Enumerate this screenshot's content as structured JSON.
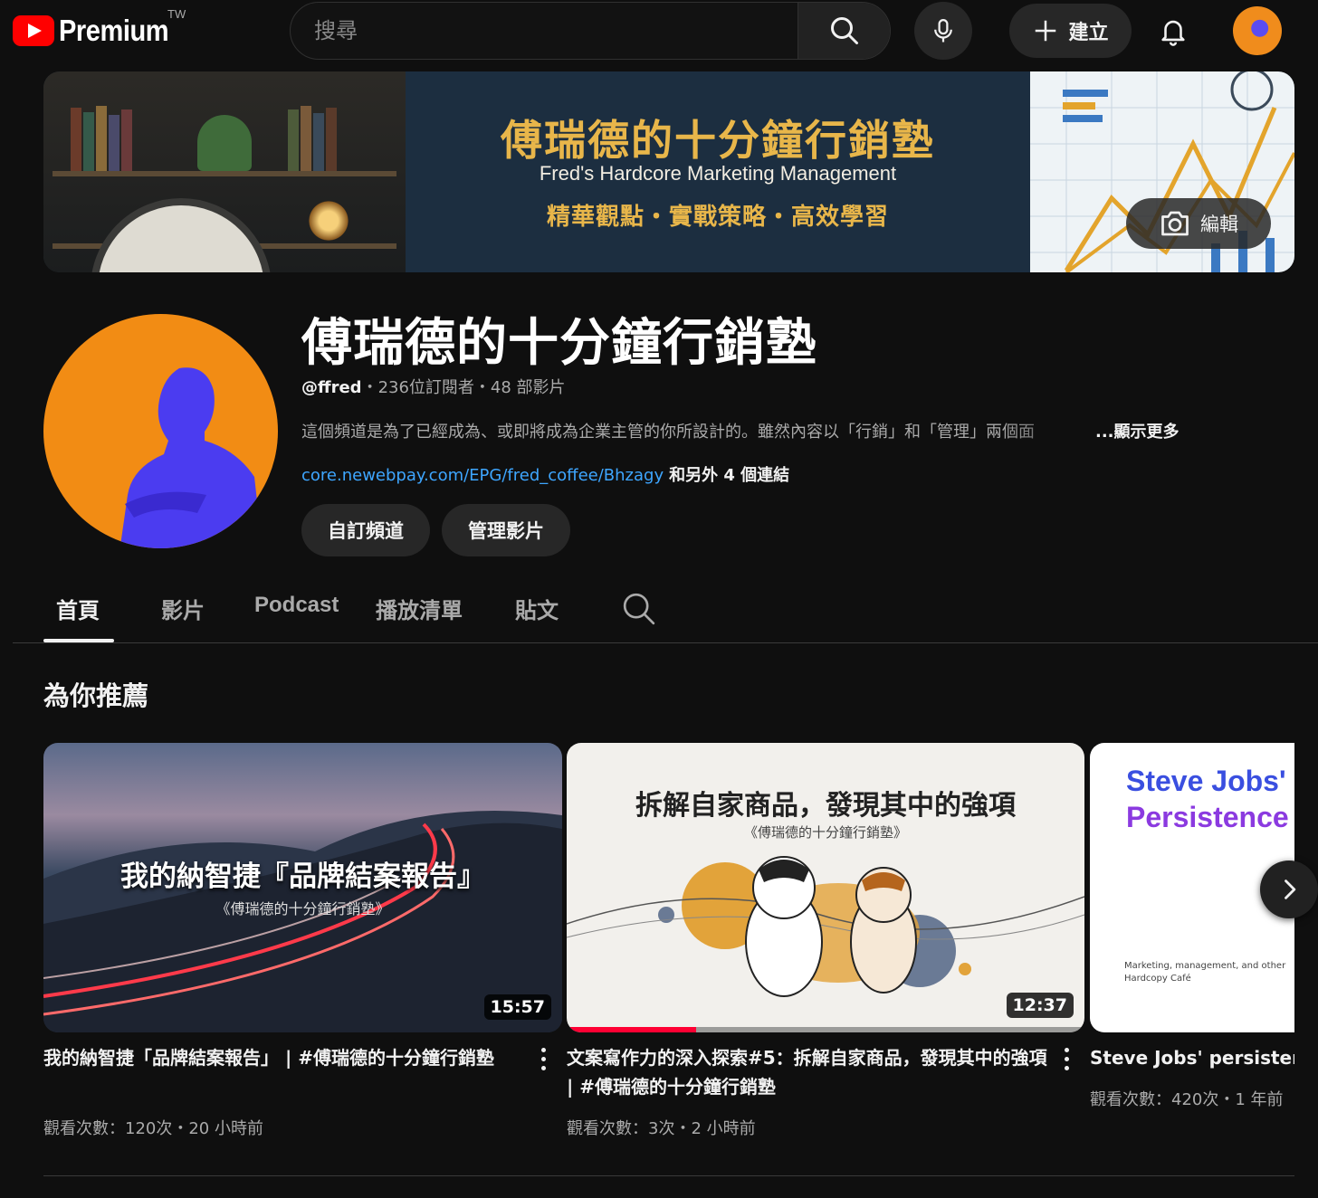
{
  "header": {
    "logo_text": "Premium",
    "region": "TW",
    "search_placeholder": "搜尋",
    "create_label": "建立"
  },
  "banner": {
    "title": "傅瑞德的十分鐘行銷塾",
    "subtitle": "Fred's Hardcore Marketing Management",
    "tagline": "精華觀點・實戰策略・高效學習",
    "edit_label": "編輯"
  },
  "channel": {
    "name": "傅瑞德的十分鐘行銷塾",
    "handle": "@ffred",
    "subscribers": "236位訂閱者",
    "video_count": "48 部影片",
    "separator": "・",
    "description": "這個頻道是為了已經成為、或即將成為企業主管的你所設計的。雖然內容以「行銷」和「管理」兩個面",
    "show_more": "...顯示更多",
    "link_url": "core.newebpay.com/EPG/fred_coffee/Bhzagy",
    "link_more": "和另外 4 個連結",
    "customize_label": "自訂頻道",
    "manage_label": "管理影片"
  },
  "tabs": [
    {
      "label": "首頁",
      "active": true
    },
    {
      "label": "影片"
    },
    {
      "label": "Podcast"
    },
    {
      "label": "播放清單"
    },
    {
      "label": "貼文"
    }
  ],
  "section": {
    "title": "為你推薦"
  },
  "videos": [
    {
      "thumb_title": "我的納智捷『品牌結案報告』",
      "thumb_sub": "《傅瑞德的十分鐘行銷塾》",
      "duration": "15:57",
      "title": "我的納智捷「品牌結案報告」 | #傅瑞德的十分鐘行銷塾",
      "views": "觀看次數：120次",
      "age": "20 小時前"
    },
    {
      "thumb_title": "拆解自家商品，發現其中的強項",
      "thumb_sub": "《傅瑞德的十分鐘行銷塾》",
      "duration": "12:37",
      "progress": 0.25,
      "title": "文案寫作力的深入探索#5：拆解自家商品，發現其中的強項 | #傅瑞德的十分鐘行銷塾",
      "views": "觀看次數：3次",
      "age": "2 小時前"
    },
    {
      "thumb_title_1": "Steve Jobs'",
      "thumb_title_2": "Persistence",
      "thumb_caption_1": "Marketing, management, and other",
      "thumb_caption_2": "Hardcopy Café",
      "title": "Steve Jobs' persistenc",
      "views": "觀看次數：420次",
      "age": "1 年前"
    }
  ],
  "colors": {
    "background": "#0f0f0f",
    "link": "#3ea6ff",
    "brand_red": "#ff0000",
    "banner_gold": "#e8b64a",
    "avatar_orange": "#f28c14",
    "avatar_figure": "#5a4cf0"
  },
  "icons": {
    "search": "search-icon",
    "mic": "mic-icon",
    "create": "plus-icon",
    "notifications": "bell-icon",
    "edit": "camera-icon",
    "more": "kebab-icon",
    "next": "chevron-right-icon"
  }
}
